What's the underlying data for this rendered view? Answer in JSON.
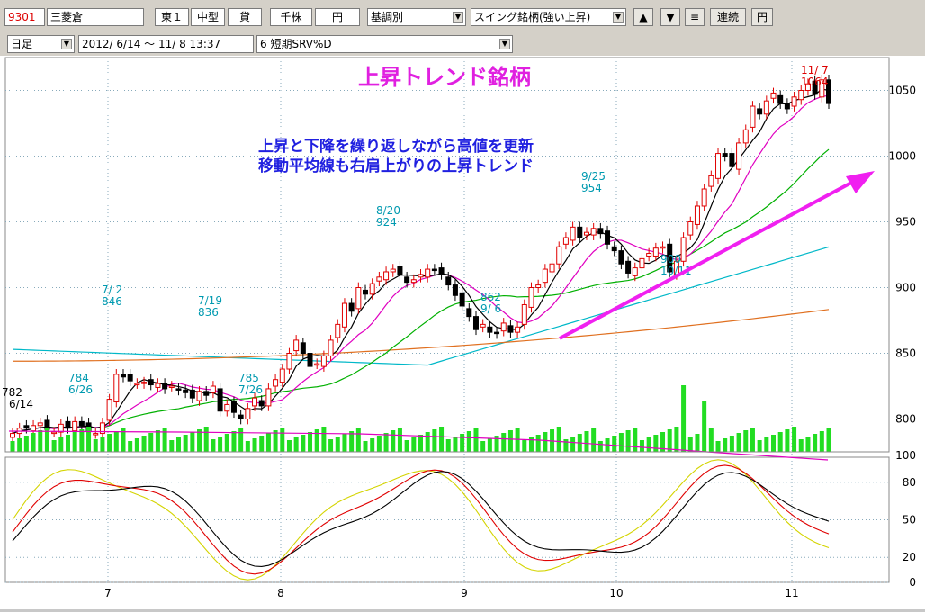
{
  "toolbar": {
    "code": "9301",
    "name": "三菱倉",
    "market": "東１",
    "size": "中型",
    "lending": "貸",
    "unit": "千株",
    "currency": "円",
    "mode": "基調別",
    "screen": "スイング銘柄(強い上昇)",
    "up_arrow": "▲",
    "down_arrow": "▼",
    "menu": "≡",
    "continuous": "連続",
    "yen_btn": "円",
    "period": "日足",
    "range": "2012/ 6/14 ～ 11/ 8 13:37",
    "indicator": "6 短期SRV%D"
  },
  "chart_data": {
    "type": "candlestick",
    "title": "上昇トレンド銘柄",
    "annotation_lines": [
      "上昇と下降を繰り返しながら高値を更新",
      "移動平均線も右肩上がりの上昇トレンド"
    ],
    "price_axis": {
      "ticks": [
        800,
        850,
        900,
        950,
        1000,
        1050
      ],
      "range": [
        775,
        1075
      ]
    },
    "oscillator_axis": {
      "ticks": [
        100,
        80,
        50,
        20,
        0
      ]
    },
    "month_labels": [
      "7",
      "8",
      "9",
      "10",
      "11"
    ],
    "price_labels": [
      {
        "text": "782",
        "sub": "6/14",
        "kind": "low"
      },
      {
        "text": "7/ 2",
        "sub": "846",
        "kind": "high"
      },
      {
        "text": "784",
        "sub": "6/26",
        "kind": "low"
      },
      {
        "text": "7/19",
        "sub": "836",
        "kind": "high"
      },
      {
        "text": "785",
        "sub": "7/26",
        "kind": "low"
      },
      {
        "text": "8/20",
        "sub": "924",
        "kind": "high"
      },
      {
        "text": "862",
        "sub": "9/ 6",
        "kind": "low"
      },
      {
        "text": "9/25",
        "sub": "954",
        "kind": "high"
      },
      {
        "text": "900",
        "sub": "10/11",
        "kind": "low"
      },
      {
        "text": "11/ 7",
        "sub": "1064",
        "kind": "high"
      }
    ],
    "closes": [
      789,
      793,
      793,
      795,
      797,
      792,
      790,
      796,
      793,
      798,
      795,
      791,
      789,
      797,
      815,
      834,
      832,
      829,
      827,
      828,
      826,
      827,
      823,
      825,
      822,
      820,
      816,
      821,
      818,
      825,
      806,
      811,
      805,
      800,
      808,
      816,
      810,
      823,
      830,
      838,
      850,
      860,
      850,
      840,
      842,
      848,
      860,
      872,
      888,
      882,
      900,
      895,
      903,
      908,
      912,
      914,
      910,
      904,
      906,
      910,
      914,
      913,
      910,
      902,
      894,
      886,
      878,
      868,
      872,
      866,
      865,
      873,
      866,
      870,
      887,
      900,
      902,
      914,
      918,
      931,
      938,
      946,
      938,
      942,
      945,
      941,
      933,
      928,
      918,
      911,
      915,
      922,
      926,
      930,
      931,
      912,
      920,
      938,
      950,
      962,
      975,
      985,
      1002,
      1000,
      992,
      1010,
      1020,
      1038,
      1032,
      1042,
      1048,
      1040,
      1036,
      1045,
      1050,
      1055,
      1047,
      1058,
      1040
    ]
  }
}
